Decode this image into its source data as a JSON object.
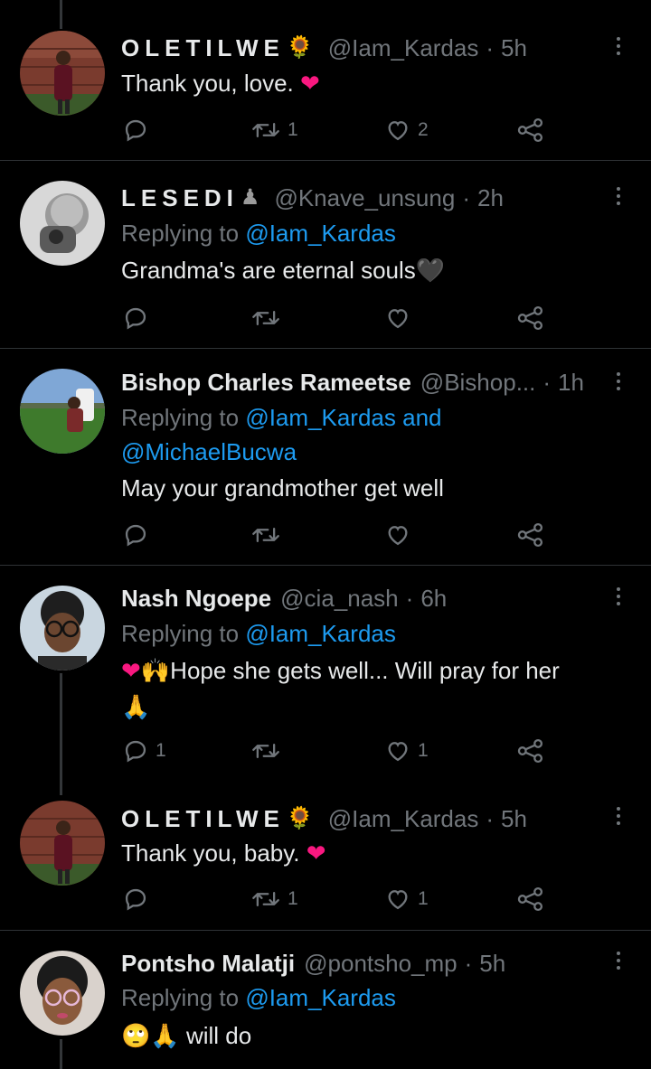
{
  "tweets": [
    {
      "name": "OLETILWE",
      "name_emoji": "🌻",
      "handle": "@Iam_Kardas",
      "time": "5h",
      "replying": null,
      "text": "Thank you, love.",
      "text_emoji": "❤",
      "counts": {
        "reply": "",
        "retweet": "1",
        "like": "2"
      }
    },
    {
      "name": "LESEDI",
      "name_emoji": "♟",
      "handle": "@Knave_unsung",
      "time": "2h",
      "replying": {
        "prefix": "Replying to",
        "mentions": "@Iam_Kardas"
      },
      "text": "Grandma's are eternal souls",
      "text_emoji": "🖤",
      "counts": {
        "reply": "",
        "retweet": "",
        "like": ""
      }
    },
    {
      "name": "Bishop Charles Rameetse",
      "handle": "@Bishop...",
      "time": "1h",
      "replying": {
        "prefix": "Replying to",
        "mentions": "@Iam_Kardas and",
        "mentions2": "@MichaelBucwa"
      },
      "text": "May your grandmother get well",
      "counts": {
        "reply": "",
        "retweet": "",
        "like": ""
      }
    },
    {
      "name": "Nash Ngoepe",
      "handle": "@cia_nash",
      "time": "6h",
      "replying": {
        "prefix": "Replying to",
        "mentions": "@Iam_Kardas"
      },
      "text_lead_emoji": "❤🙌",
      "text": "Hope she gets well... Will pray for her",
      "text_line2": "🙏",
      "counts": {
        "reply": "1",
        "retweet": "",
        "like": "1"
      }
    },
    {
      "name": "OLETILWE",
      "name_emoji": "🌻",
      "handle": "@Iam_Kardas",
      "time": "5h",
      "replying": null,
      "text": "Thank you, baby.",
      "text_emoji": "❤",
      "counts": {
        "reply": "",
        "retweet": "1",
        "like": "1"
      }
    },
    {
      "name": "Pontsho Malatji",
      "handle": "@pontsho_mp",
      "time": "5h",
      "replying": {
        "prefix": "Replying to",
        "mentions": "@Iam_Kardas"
      },
      "text_lead_emoji": "🙄🙏",
      "text": " will do",
      "counts": {
        "reply": "",
        "retweet": "",
        "like": ""
      }
    }
  ],
  "dot_separator": "·",
  "colors": {
    "background": "#000000",
    "text": "#e7e9ea",
    "muted": "#71767b",
    "link": "#1d9bf0",
    "heart": "#f91880"
  },
  "icons": [
    "reply-icon",
    "retweet-icon",
    "like-icon",
    "share-icon",
    "more-icon"
  ]
}
